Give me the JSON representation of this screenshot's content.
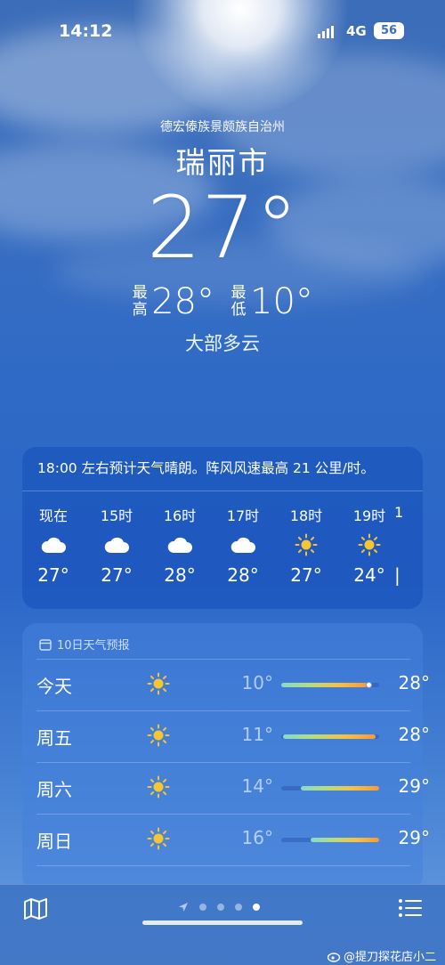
{
  "status_bar": {
    "time": "14:12",
    "network": "4G",
    "battery": "56"
  },
  "location": {
    "region": "德宏傣族景颇族自治州",
    "city": "瑞丽市"
  },
  "current": {
    "temp": "27°",
    "high_label": "最高",
    "high": "28°",
    "low_label": "最低",
    "low": "10°",
    "condition": "大部多云"
  },
  "hourly": {
    "summary": "18:00 左右预计天气晴朗。阵风风速最高 21 公里/时。",
    "items": [
      {
        "label": "现在",
        "icon": "cloud-icon",
        "temp": "27°"
      },
      {
        "label": "15时",
        "icon": "cloud-icon",
        "temp": "27°"
      },
      {
        "label": "16时",
        "icon": "cloud-icon",
        "temp": "28°"
      },
      {
        "label": "17时",
        "icon": "cloud-icon",
        "temp": "28°"
      },
      {
        "label": "18时",
        "icon": "sun-icon",
        "temp": "27°"
      },
      {
        "label": "19时",
        "icon": "sun-icon",
        "temp": "24°"
      },
      {
        "label": "1",
        "icon": "partial",
        "temp": ""
      }
    ]
  },
  "daily": {
    "title": "10日天气预报",
    "items": [
      {
        "day": "今天",
        "icon": "sun-icon",
        "low": "10°",
        "high": "28°",
        "range_start": 0.0,
        "range_end": 0.88,
        "current_marker": 0.9
      },
      {
        "day": "周五",
        "icon": "sun-icon",
        "low": "11°",
        "high": "28°",
        "range_start": 0.02,
        "range_end": 0.96
      },
      {
        "day": "周六",
        "icon": "sun-icon",
        "low": "14°",
        "high": "29°",
        "range_start": 0.2,
        "range_end": 1.0
      },
      {
        "day": "周日",
        "icon": "sun-icon",
        "low": "16°",
        "high": "29°",
        "range_start": 0.3,
        "range_end": 1.0
      }
    ]
  },
  "bottom_bar": {
    "watermark": "@提刀探花店小二"
  },
  "colors": {
    "sun": "#f6c531",
    "bar_start": "#86d9d0",
    "bar_end": "#f59a3a"
  }
}
